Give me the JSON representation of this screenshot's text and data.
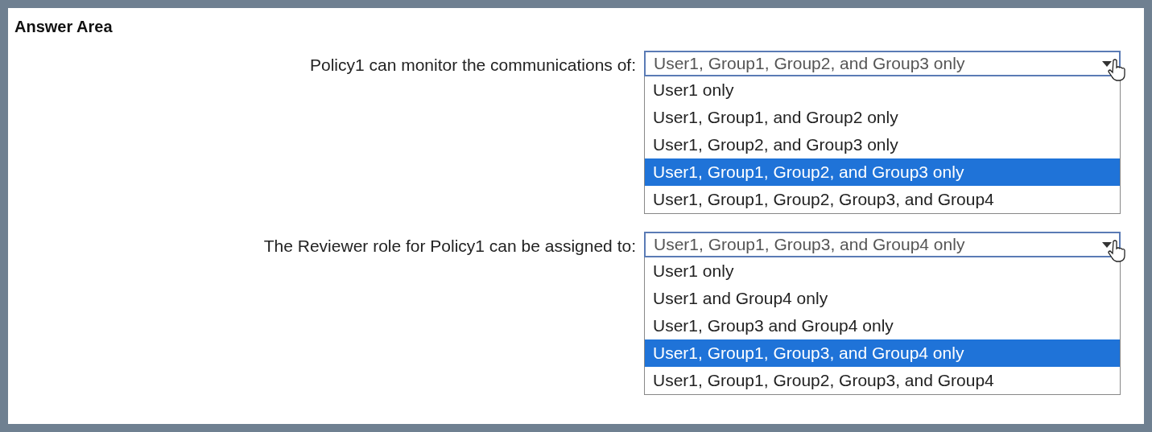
{
  "heading": "Answer Area",
  "questions": [
    {
      "label": "Policy1 can monitor the communications of:",
      "value": "User1, Group1, Group2, and Group3 only",
      "options": [
        {
          "text": "User1 only",
          "selected": false
        },
        {
          "text": "User1, Group1, and Group2 only",
          "selected": false
        },
        {
          "text": "User1, Group2, and Group3 only",
          "selected": false
        },
        {
          "text": "User1, Group1, Group2, and Group3 only",
          "selected": true
        },
        {
          "text": "User1, Group1, Group2, Group3, and Group4",
          "selected": false
        }
      ]
    },
    {
      "label": "The Reviewer role for Policy1 can be assigned to:",
      "value": "User1, Group1, Group3, and Group4 only",
      "options": [
        {
          "text": "User1 only",
          "selected": false
        },
        {
          "text": "User1 and Group4 only",
          "selected": false
        },
        {
          "text": "User1, Group3 and Group4 only",
          "selected": false
        },
        {
          "text": "User1, Group1, Group3, and Group4 only",
          "selected": true
        },
        {
          "text": "User1, Group1, Group2, Group3, and Group4",
          "selected": false
        }
      ]
    }
  ]
}
